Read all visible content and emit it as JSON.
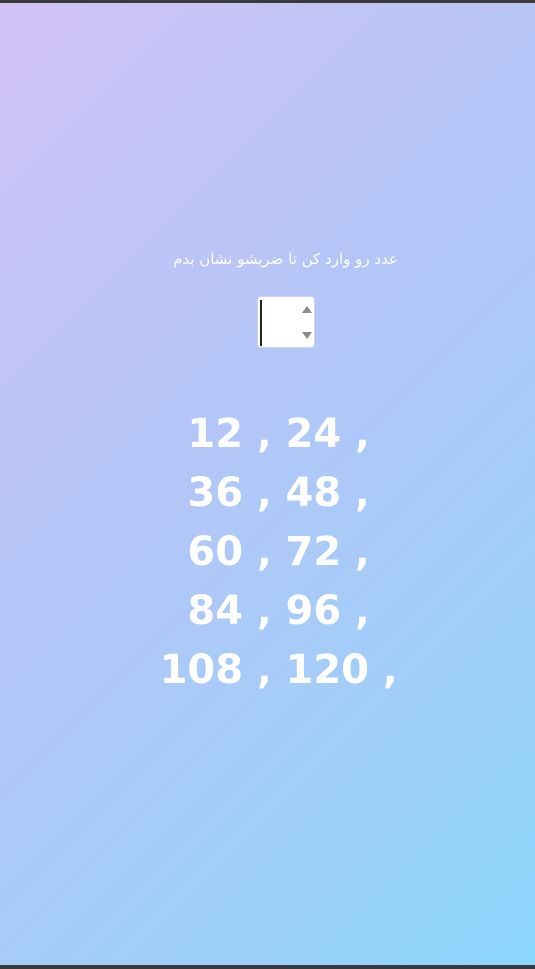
{
  "prompt_text": "عدد رو وارد کن تا ضربشو نشان بدم",
  "input": {
    "value": "",
    "type": "number"
  },
  "results": {
    "separator": ",",
    "rows": [
      [
        "12",
        "24"
      ],
      [
        "36",
        "48"
      ],
      [
        "60",
        "72"
      ],
      [
        "84",
        "96"
      ],
      [
        "108",
        "120"
      ]
    ]
  }
}
